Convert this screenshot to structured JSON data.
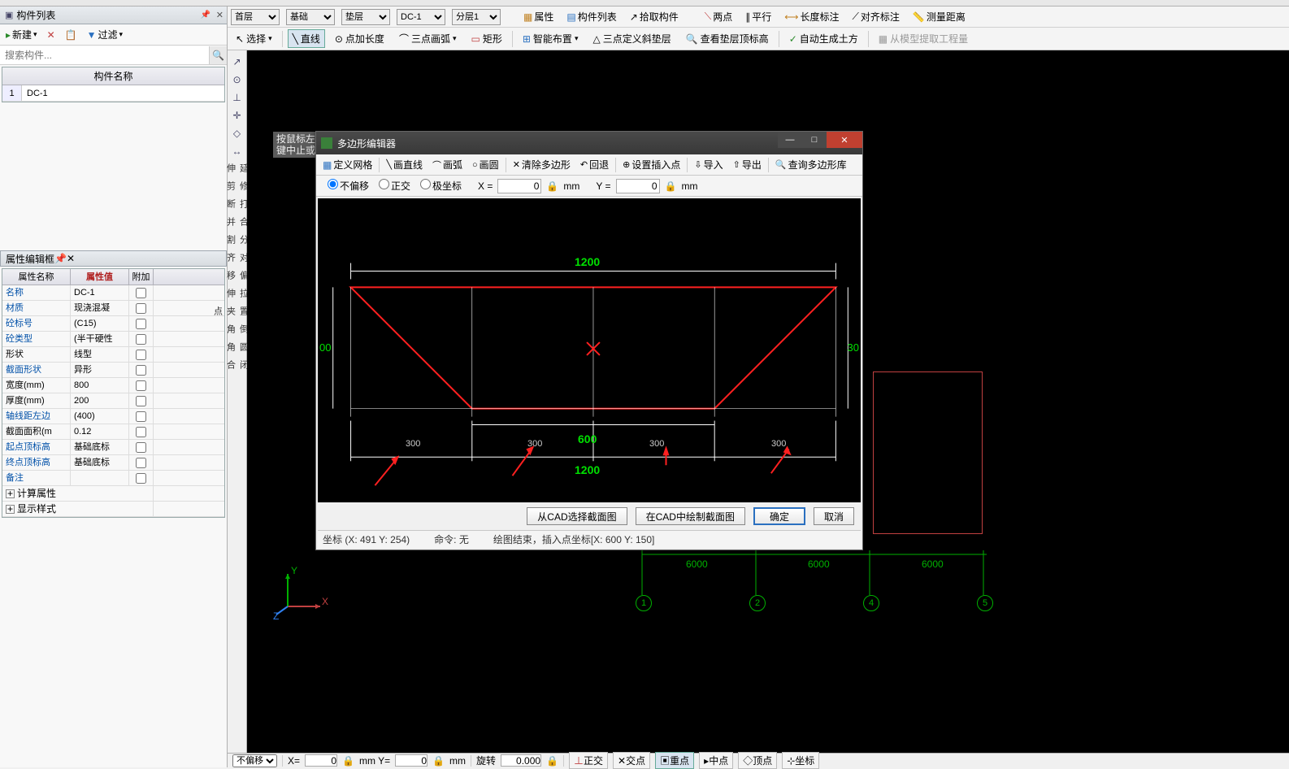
{
  "panels": {
    "componentList": {
      "title": "构件列表",
      "newBtn": "新建",
      "filterBtn": "过滤",
      "searchPlaceholder": "搜索构件...",
      "header": "构件名称",
      "rows": [
        {
          "idx": "1",
          "name": "DC-1"
        }
      ]
    },
    "propEditor": {
      "title": "属性编辑框",
      "cols": {
        "name": "属性名称",
        "value": "属性值",
        "extra": "附加"
      },
      "rows": [
        {
          "n": "名称",
          "v": "DC-1",
          "blue": true
        },
        {
          "n": "材质",
          "v": "现浇混凝",
          "blue": true
        },
        {
          "n": "砼标号",
          "v": "(C15)",
          "blue": true
        },
        {
          "n": "砼类型",
          "v": "(半干硬性",
          "blue": true
        },
        {
          "n": "形状",
          "v": "线型",
          "blue": false
        },
        {
          "n": "截面形状",
          "v": "异形",
          "blue": true
        },
        {
          "n": "宽度(mm)",
          "v": "800",
          "blue": false
        },
        {
          "n": "厚度(mm)",
          "v": "200",
          "blue": false
        },
        {
          "n": "轴线距左边",
          "v": "(400)",
          "blue": true
        },
        {
          "n": "截面面积(m",
          "v": "0.12",
          "blue": false
        },
        {
          "n": "起点顶标高",
          "v": "基础底标",
          "blue": true
        },
        {
          "n": "终点顶标高",
          "v": "基础底标",
          "blue": true
        },
        {
          "n": "备注",
          "v": "",
          "blue": true
        }
      ],
      "expandRows": [
        {
          "label": "计算属性"
        },
        {
          "label": "显示样式"
        }
      ]
    }
  },
  "ribbon1": {
    "floor": "首层",
    "type": "基础",
    "layer": "垫层",
    "comp": "DC-1",
    "sub": "分层1",
    "btns": {
      "attr": "属性",
      "list": "构件列表",
      "pick": "拾取构件",
      "twoPt": "两点",
      "parallel": "平行",
      "lenDim": "长度标注",
      "alignDim": "对齐标注",
      "measure": "测量距离"
    }
  },
  "ribbon2": {
    "select": "选择",
    "line": "直线",
    "ptLen": "点加长度",
    "arc3": "三点画弧",
    "rect": "矩形",
    "smart": "智能布置",
    "slope": "三点定义斜垫层",
    "viewTop": "查看垫层顶标高",
    "autoSoil": "自动生成土方",
    "fromModel": "从模型提取工程量"
  },
  "sideTools": [
    "延伸",
    "修剪",
    "打断",
    "合并",
    "分割",
    "对齐",
    "偏移",
    "拉伸",
    "设置夹点",
    "倒角",
    "圆角",
    "闭合"
  ],
  "canvas": {
    "tooltip1": "按鼠标左键",
    "tooltip2": "键中止或",
    "gridDims": [
      "6000",
      "6000",
      "6000"
    ],
    "gridLabels": [
      "1",
      "2",
      "4",
      "5"
    ]
  },
  "dialog": {
    "title": "多边形编辑器",
    "tb": {
      "grid": "定义网格",
      "line": "画直线",
      "arc": "画弧",
      "circle": "画圆",
      "clear": "清除多边形",
      "undo": "回退",
      "insert": "设置插入点",
      "import": "导入",
      "export": "导出",
      "query": "查询多边形库"
    },
    "coord": {
      "noOff": "不偏移",
      "ortho": "正交",
      "polar": "极坐标",
      "x": "X =",
      "y": "Y =",
      "xv": "0",
      "yv": "0",
      "unit": "mm"
    },
    "dims": {
      "top": "1200",
      "bottom": "1200",
      "mid": "600",
      "seg": [
        "300",
        "300",
        "300",
        "300"
      ],
      "left": "00",
      "right": "30"
    },
    "footer": {
      "fromCAD": "从CAD选择截面图",
      "toCAD": "在CAD中绘制截面图",
      "ok": "确定",
      "cancel": "取消"
    },
    "status": {
      "coord": "坐标 (X: 491 Y: 254)",
      "cmd": "命令: 无",
      "msg": "绘图结束，插入点坐标[X: 600 Y: 150]"
    }
  },
  "statusBar": {
    "noOff": "不偏移",
    "x": "X=",
    "xv": "0",
    "y": "mm Y=",
    "yv": "0",
    "unit": "mm",
    "rot": "旋转",
    "rotv": "0.000",
    "ortho": "正交",
    "cross": "交点",
    "center": "重点",
    "mid": "中点",
    "top": "顶点",
    "sit": "坐标"
  }
}
